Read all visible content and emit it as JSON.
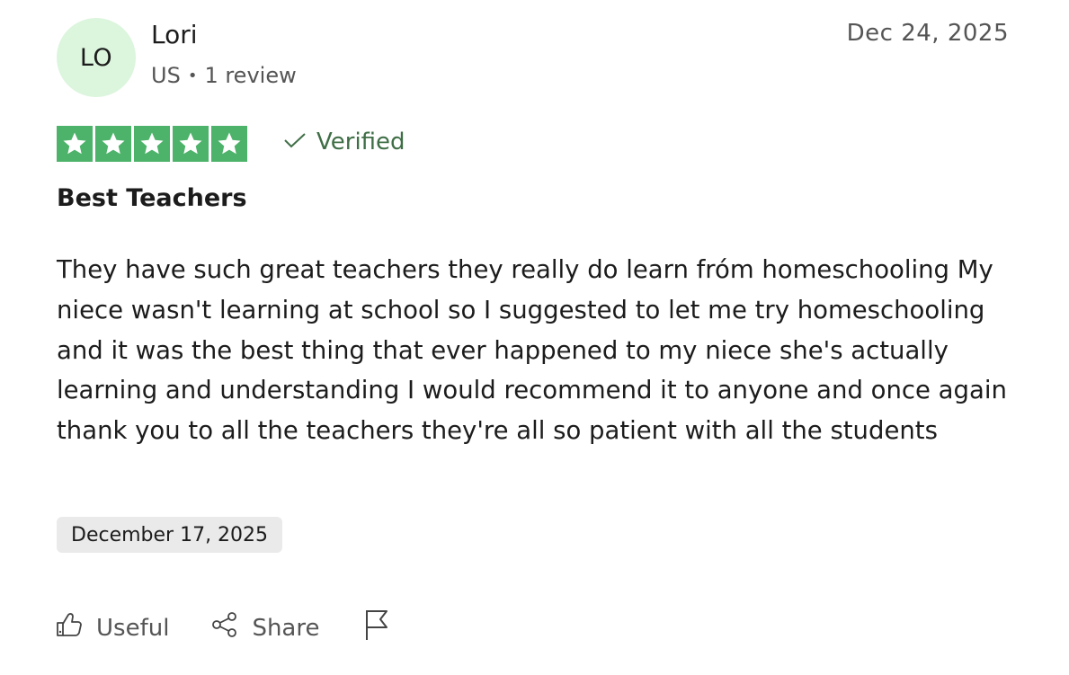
{
  "reviewer": {
    "initials": "LO",
    "name": "Lori",
    "country": "US",
    "separator": "•",
    "review_count": "1 review",
    "avatar_color": "#dcf5dd"
  },
  "review": {
    "posted_date": "Dec 24, 2025",
    "rating": 5,
    "rating_max": 5,
    "star_color": "#4db26a",
    "verified_label": "Verified",
    "verified_icon": "check-icon",
    "title": "Best Teachers",
    "body": "They have such great teachers they really do learn fróm homeschooling My niece wasn't learning at school so I suggested to let me try homeschooling and it was the best thing that ever happened to my niece she's actually learning and understanding I would recommend it to anyone and once again thank you to all the teachers they're all so patient with all the students",
    "experience_date": "December 17, 2025"
  },
  "actions": {
    "useful_label": "Useful",
    "useful_icon": "thumbs-up-icon",
    "share_label": "Share",
    "share_icon": "share-icon",
    "report_icon": "flag-icon"
  }
}
